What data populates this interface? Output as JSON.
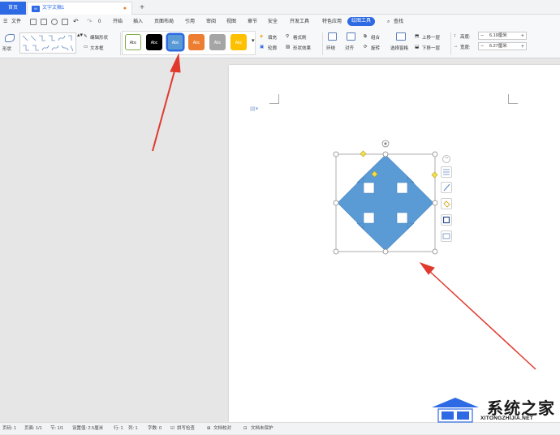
{
  "tabs": {
    "home": "首页",
    "doc": "文字文稿1",
    "add": "+"
  },
  "menu": {
    "file": "文件",
    "undo_extra": "0",
    "items": [
      "开始",
      "插入",
      "页面布局",
      "引用",
      "审阅",
      "视图",
      "章节",
      "安全",
      "开发工具",
      "特色应用",
      "绘图工具"
    ],
    "active": "绘图工具",
    "search": "查找"
  },
  "ribbon": {
    "shape_label": "形状",
    "edit_shape": "编辑形状",
    "text_box": "文本框",
    "style_swatches": [
      {
        "label": "Abc",
        "bg": "#ffffff",
        "fg": "#333333",
        "border": "#7fb04a"
      },
      {
        "label": "Abc",
        "bg": "#000000",
        "fg": "#ffffff",
        "border": "#000000"
      },
      {
        "label": "Abc",
        "bg": "#5b9bd5",
        "fg": "#ffffff",
        "border": "#2d6ae3"
      },
      {
        "label": "Abc",
        "bg": "#ed7d31",
        "fg": "#ffffff",
        "border": "#ed7d31"
      },
      {
        "label": "Abc",
        "bg": "#a5a5a5",
        "fg": "#ffffff",
        "border": "#a5a5a5"
      },
      {
        "label": "Abc",
        "bg": "#ffc000",
        "fg": "#ffffff",
        "border": "#ffc000"
      }
    ],
    "fill": "填充",
    "format_painter": "格式刷",
    "outline": "轮廓",
    "shape_effects": "形状效果",
    "wrap": "环绕",
    "align": "对齐",
    "group": "组合",
    "rotate": "旋转",
    "selection_pane": "选择窗格",
    "bring_forward": "上移一层",
    "send_backward": "下移一层",
    "height_label": "高度:",
    "height_value": "6.19厘米",
    "width_label": "宽度:",
    "width_value": "6.27厘米"
  },
  "status": {
    "page_no": "页码: 1",
    "pages": "页面: 1/1",
    "section": "节: 1/1",
    "setting": "设置值: 2.5厘米",
    "row": "行: 1",
    "col": "列: 1",
    "words": "字数: 0",
    "spell": "拼写检查",
    "proof": "文档校对",
    "protect": "文档未保护"
  },
  "watermark": {
    "text": "系统之家",
    "url": "XITONGZHIJIA.NET"
  },
  "colors": {
    "accent": "#2d6ae3",
    "shape": "#5b9bd5",
    "arrow": "#e03a2f"
  }
}
